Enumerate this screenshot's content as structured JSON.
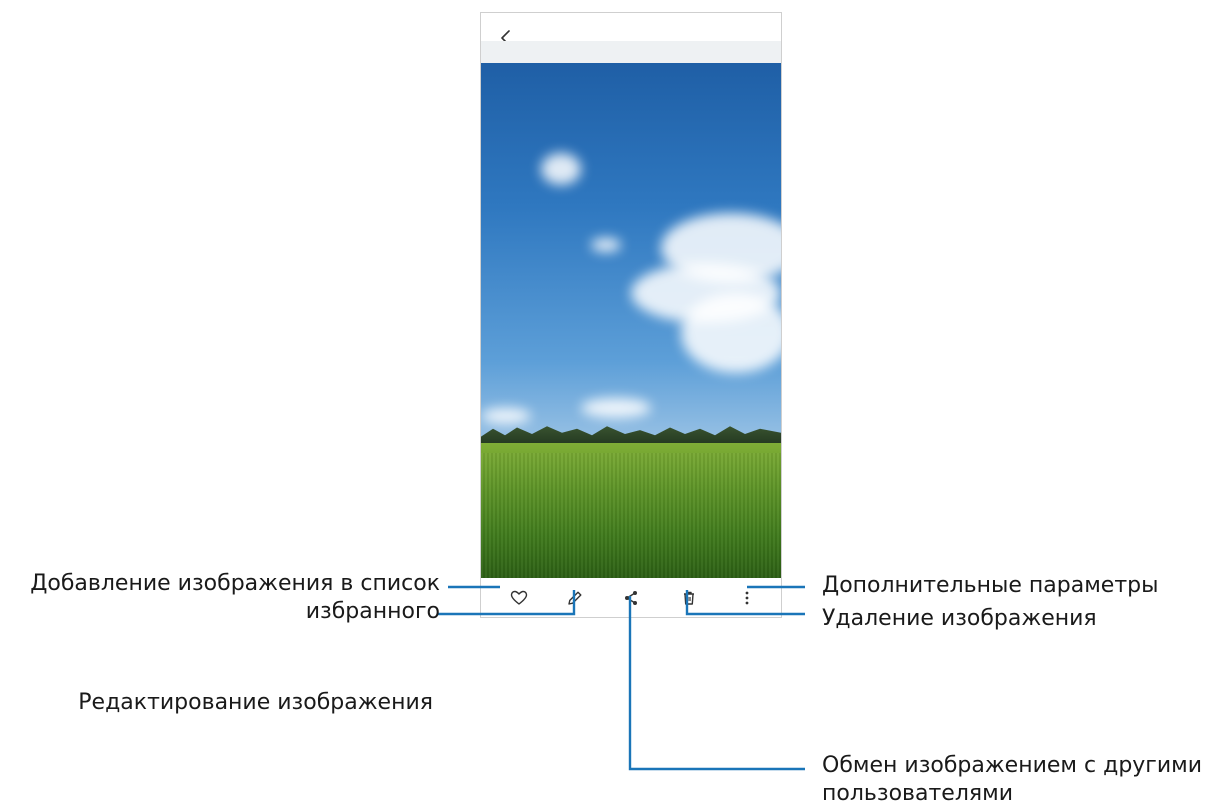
{
  "screen": {
    "back": "back-arrow-icon"
  },
  "toolbar": {
    "buttons": [
      {
        "name": "favorite",
        "icon": "heart-icon"
      },
      {
        "name": "edit",
        "icon": "pencil-icon"
      },
      {
        "name": "share",
        "icon": "share-icon"
      },
      {
        "name": "delete",
        "icon": "trash-icon"
      },
      {
        "name": "more",
        "icon": "more-vertical-icon"
      }
    ]
  },
  "callouts": {
    "favorite_line1": "Добавление изображения в список",
    "favorite_line2": "избранного",
    "edit": "Редактирование изображения",
    "more": "Дополнительные параметры",
    "delete": "Удаление изображения",
    "share_line1": "Обмен изображением с другими",
    "share_line2": "пользователями"
  },
  "colors": {
    "leader_line": "#1a75b8",
    "sky": "#2f78c0",
    "field": "#5d9427"
  }
}
